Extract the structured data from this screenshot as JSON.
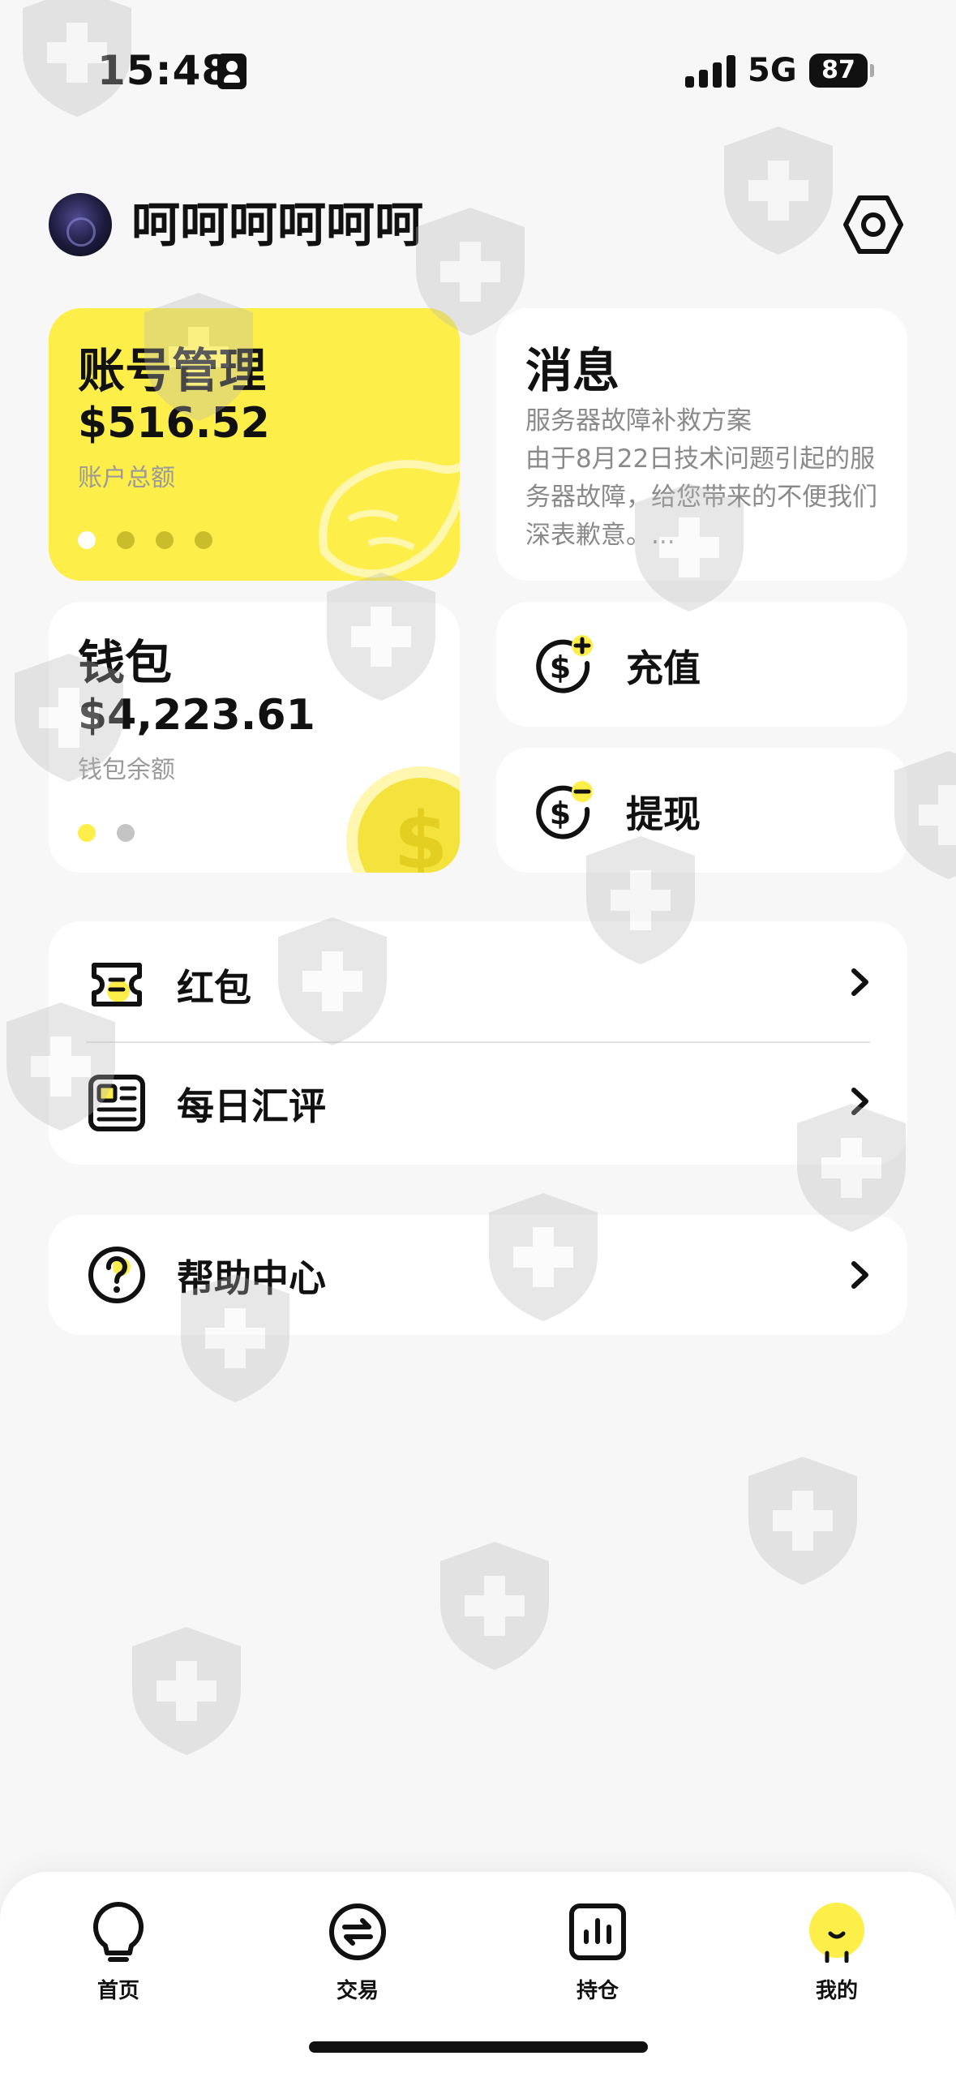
{
  "status_bar": {
    "time": "15:48",
    "network": "5G",
    "battery": "87"
  },
  "header": {
    "username": "呵呵呵呵呵呵"
  },
  "account_card": {
    "title": "账号管理",
    "amount": "$516.52",
    "subtitle": "账户总额",
    "color": "#fdee4a"
  },
  "message_card": {
    "title": "消息",
    "body": "服务器故障补救方案\n由于8月22日技术问题引起的服务器故障，给您带来的不便我们深表歉意。..."
  },
  "wallet_card": {
    "title": "钱包",
    "amount": "$4,223.61",
    "subtitle": "钱包余额"
  },
  "actions": {
    "deposit_label": "充值",
    "withdraw_label": "提现"
  },
  "menu": {
    "red_packet": "红包",
    "daily_review": "每日汇评",
    "help_center": "帮助中心"
  },
  "bottom_nav": {
    "home": "首页",
    "trade": "交易",
    "positions": "持仓",
    "mine": "我的"
  },
  "colors": {
    "accent": "#fdee4a",
    "background": "#f7f7f7"
  }
}
